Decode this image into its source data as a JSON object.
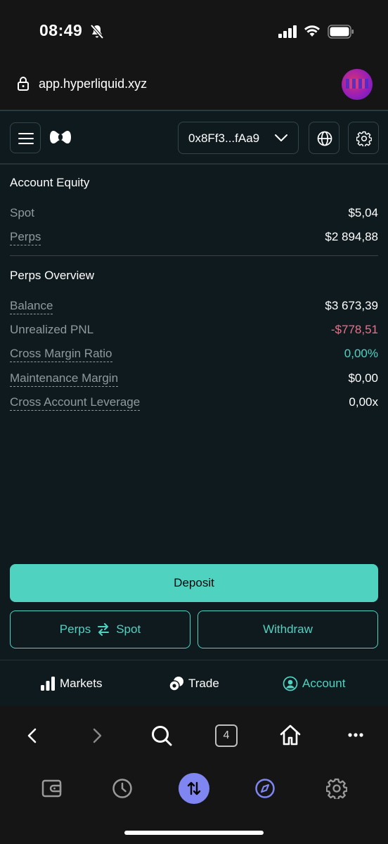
{
  "status_bar": {
    "time": "08:49"
  },
  "browser": {
    "url": "app.hyperliquid.xyz",
    "tab_count": "4"
  },
  "header": {
    "wallet_address": "0x8Ff3...fAa9"
  },
  "account_equity": {
    "title": "Account Equity",
    "rows": [
      {
        "label": "Spot",
        "value": "$5,04"
      },
      {
        "label": "Perps",
        "value": "$2 894,88"
      }
    ]
  },
  "perps_overview": {
    "title": "Perps Overview",
    "rows": [
      {
        "label": "Balance",
        "value": "$3 673,39"
      },
      {
        "label": "Unrealized PNL",
        "value": "-$778,51"
      },
      {
        "label": "Cross Margin Ratio",
        "value": "0,00%"
      },
      {
        "label": "Maintenance Margin",
        "value": "$0,00"
      },
      {
        "label": "Cross Account Leverage",
        "value": "0,00x"
      }
    ]
  },
  "actions": {
    "deposit": "Deposit",
    "transfer_left": "Perps",
    "transfer_right": "Spot",
    "withdraw": "Withdraw"
  },
  "bottom_nav": {
    "markets": "Markets",
    "trade": "Trade",
    "account": "Account"
  },
  "colors": {
    "accent": "#50d2c1",
    "negative": "#ed7088",
    "background": "#0f1a1f",
    "browser_active": "#7f86f2"
  }
}
